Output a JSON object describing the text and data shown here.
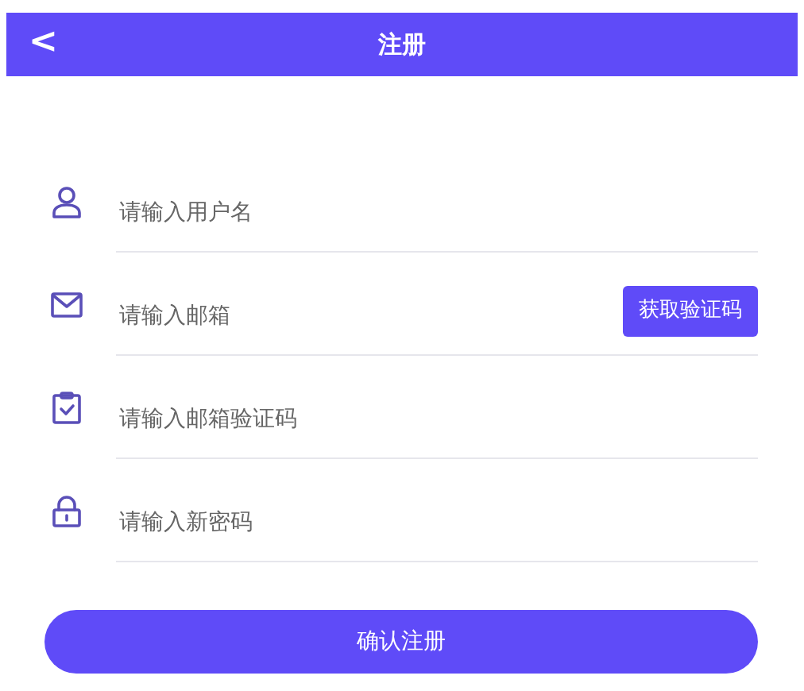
{
  "header": {
    "back": "<",
    "title": "注册"
  },
  "fields": [
    {
      "kind": "user",
      "placeholder": "请输入用户名"
    },
    {
      "kind": "mail",
      "placeholder": "请输入邮箱",
      "button": "获取验证码"
    },
    {
      "kind": "code",
      "placeholder": "请输入邮箱验证码"
    },
    {
      "kind": "lock",
      "placeholder": "请输入新密码"
    }
  ],
  "submit": "确认注册"
}
